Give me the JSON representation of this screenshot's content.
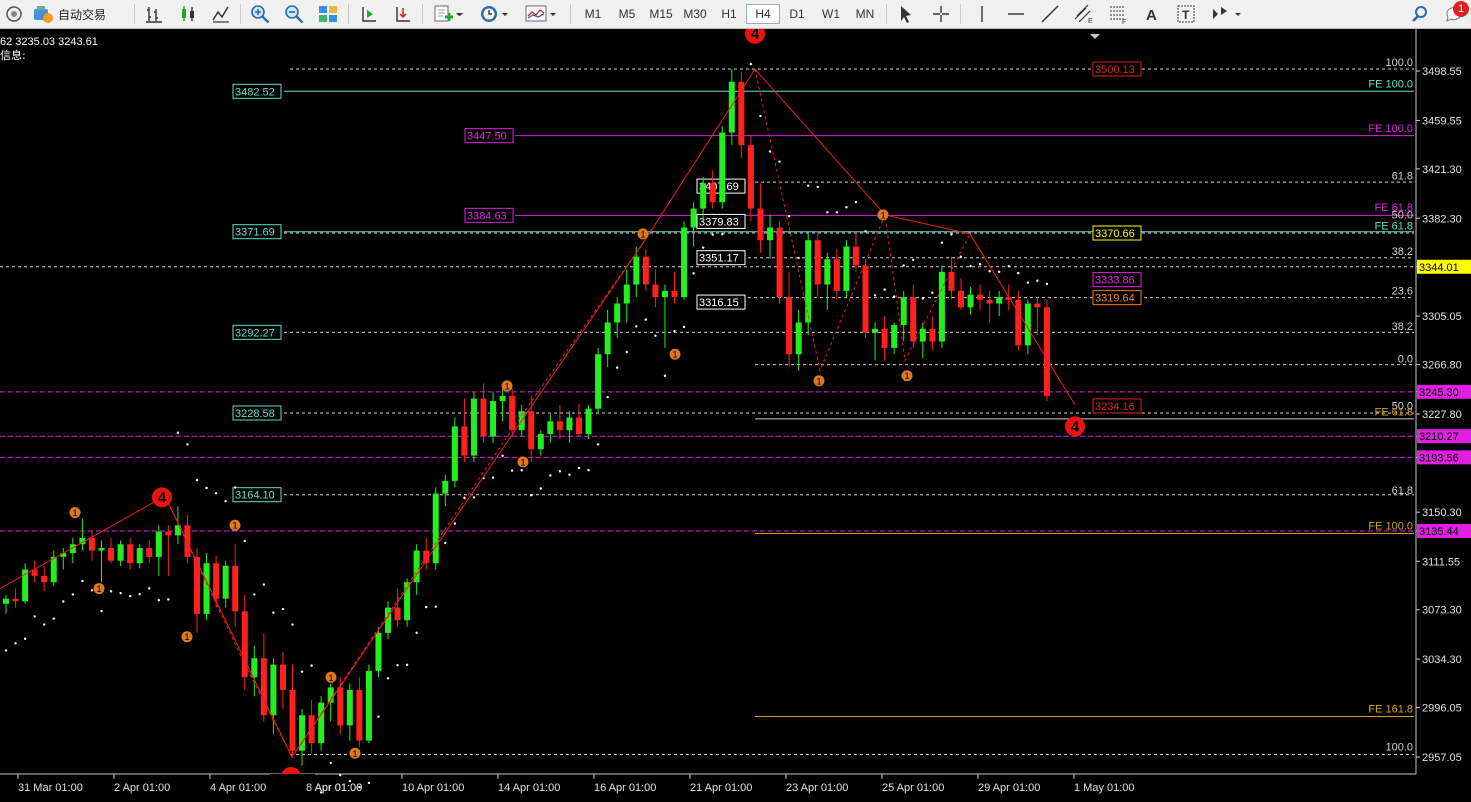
{
  "toolbar": {
    "autotrade_label": "自动交易",
    "timeframes": [
      "M1",
      "M5",
      "M15",
      "M30",
      "H1",
      "H4",
      "D1",
      "W1",
      "MN"
    ],
    "active_timeframe": "H4",
    "notification_count": "1"
  },
  "header": {
    "ohlc": "62 3235.03 3243.61",
    "info_label": "信息:"
  },
  "chart_data": {
    "type": "candlestick",
    "price_axis": [
      "3498.55",
      "3459.55",
      "3421.30",
      "3382.30",
      "3344.01",
      "3305.05",
      "3266.80",
      "3245.30",
      "3227.80",
      "3210.27",
      "3193.56",
      "3150.30",
      "3135.44",
      "3111.55",
      "3073.30",
      "3034.30",
      "2996.05",
      "2957.05"
    ],
    "time_axis": [
      "31 Mar 01:00",
      "2 Apr 01:00",
      "4 Apr 01:00",
      "8 Apr 01:00",
      "10 Apr 01:00",
      "14 Apr 01:00",
      "16 Apr 01:00",
      "21 Apr 01:00",
      "23 Apr 01:00",
      "25 Apr 01:00",
      "29 Apr 01:00",
      "1 May 01:00"
    ],
    "level_boxes": [
      "3482.52",
      "3447.50",
      "3407.69",
      "3384.63",
      "3379.83",
      "3371.69",
      "3351.17",
      "3316.15",
      "3292.27",
      "3228.58",
      "3164.10",
      "3500.13",
      "3370.66",
      "3333.86",
      "3319.64",
      "3234.16"
    ],
    "fib_labels": [
      "100.0",
      "FE 100.0",
      "FE 100.0",
      "61.8",
      "FE 61.8",
      "50.0",
      "FE 61.8",
      "38.2",
      "23.6",
      "38.2",
      "0.0",
      "50.0",
      "FE 61.8",
      "61.8",
      "FE 100.0",
      "FE 161.8",
      "100.0"
    ],
    "price_tags": [
      {
        "label": "3344.01",
        "color": "#ffff00"
      },
      {
        "label": "3245.30",
        "color": "#e020e0"
      },
      {
        "label": "3210.27",
        "color": "#e020e0"
      },
      {
        "label": "3193.56",
        "color": "#e020e0"
      },
      {
        "label": "3135.44",
        "color": "#e020e0"
      }
    ],
    "wave_markers": [
      "4",
      "4",
      "4"
    ],
    "minor_markers": [
      "1",
      "1",
      "1",
      "1",
      "1",
      "1",
      "1",
      "1",
      "1",
      "1",
      "1",
      "1",
      "1"
    ]
  }
}
